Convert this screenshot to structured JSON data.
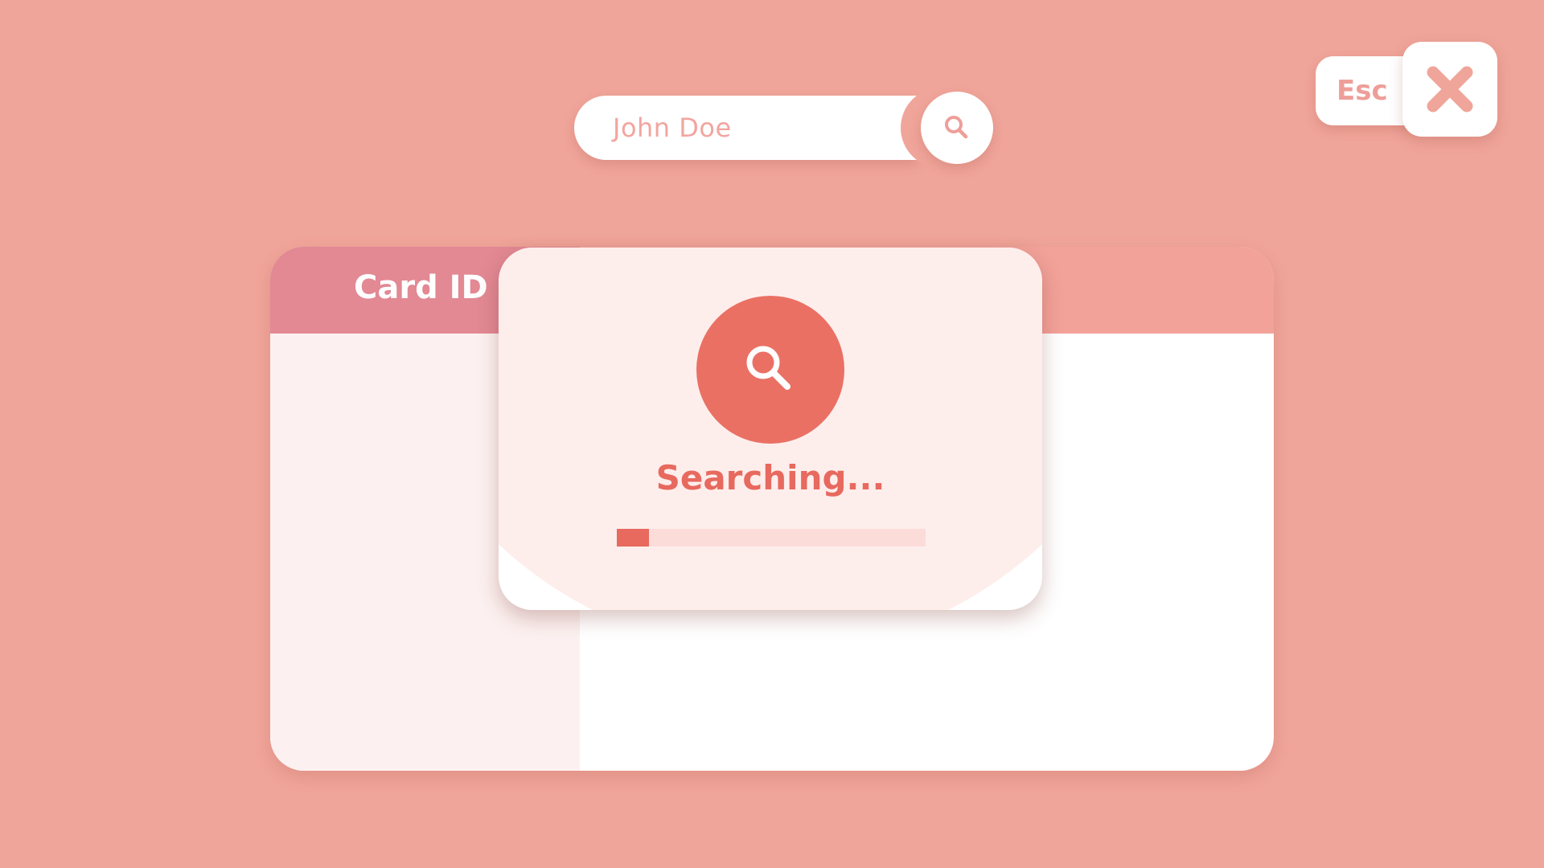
{
  "search": {
    "value": "John Doe",
    "icon": "search-icon"
  },
  "toolbar": {
    "esc_label": "Esc",
    "close_icon": "close-icon"
  },
  "card": {
    "header_label": "Card ID"
  },
  "modal": {
    "status_text": "Searching...",
    "icon": "search-icon",
    "progress": 0.105
  },
  "colors": {
    "background": "#F0A59A",
    "accent": "#E8695E",
    "header_left": "#E28994",
    "header_right": "#F2A299",
    "progress_track": "#FCDCD9"
  }
}
